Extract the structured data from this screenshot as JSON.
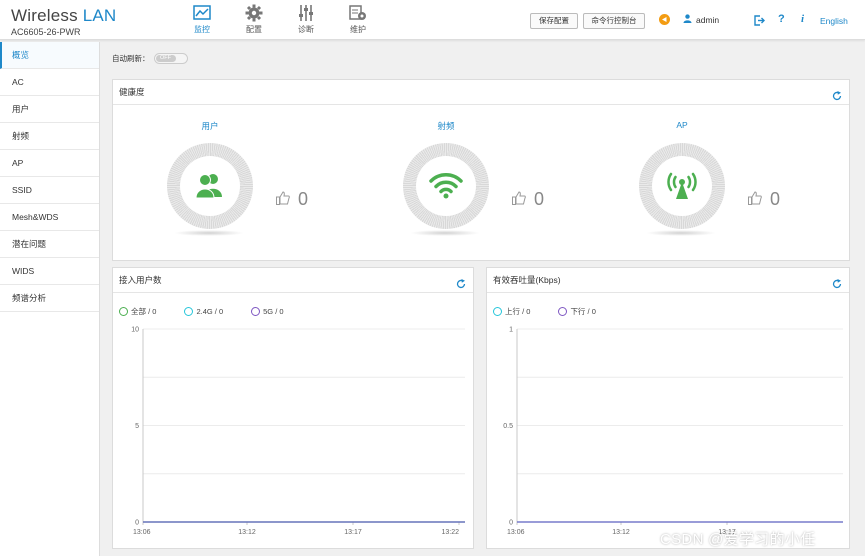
{
  "brand": {
    "title_main": "Wireless",
    "title_accent": "LAN",
    "model": "AC6605-26-PWR"
  },
  "nav": [
    {
      "label": "监控",
      "icon": "monitor-icon",
      "active": true
    },
    {
      "label": "配置",
      "icon": "gear-icon",
      "active": false
    },
    {
      "label": "诊断",
      "icon": "sliders-icon",
      "active": false
    },
    {
      "label": "维护",
      "icon": "maintenance-icon",
      "active": false
    }
  ],
  "header": {
    "save_label": "保存配置",
    "console_label": "命令行控制台",
    "user": "admin",
    "language": "English",
    "help_icon": "help-icon",
    "info_icon": "info-icon",
    "logout_icon": "logout-icon",
    "alarm_icon": "alarm-icon"
  },
  "sidebar": {
    "items": [
      {
        "label": "概览",
        "active": true
      },
      {
        "label": "AC",
        "active": false
      },
      {
        "label": "用户",
        "active": false
      },
      {
        "label": "射频",
        "active": false
      },
      {
        "label": "AP",
        "active": false
      },
      {
        "label": "SSID",
        "active": false
      },
      {
        "label": "Mesh&WDS",
        "active": false
      },
      {
        "label": "潜在问题",
        "active": false
      },
      {
        "label": "WIDS",
        "active": false
      },
      {
        "label": "频谱分析",
        "active": false
      }
    ]
  },
  "auto_refresh": {
    "label": "自动刷新：",
    "state": "OFF"
  },
  "health": {
    "title": "健康度",
    "items": [
      {
        "label": "用户",
        "icon": "users-icon",
        "score": "0"
      },
      {
        "label": "射频",
        "icon": "wifi-icon",
        "score": "0"
      },
      {
        "label": "AP",
        "icon": "access-point-icon",
        "score": "0"
      }
    ]
  },
  "users_panel": {
    "title": "接入用户数",
    "legend": [
      {
        "label": "全部 / 0",
        "color": "#4caf50"
      },
      {
        "label": "2.4G / 0",
        "color": "#26c6da"
      },
      {
        "label": "5G / 0",
        "color": "#7e57c2"
      }
    ]
  },
  "throughput_panel": {
    "title": "有效吞吐量(Kbps)",
    "legend": [
      {
        "label": "上行 / 0",
        "color": "#26c6da"
      },
      {
        "label": "下行 / 0",
        "color": "#7e57c2"
      }
    ]
  },
  "chart_data": [
    {
      "type": "line",
      "title": "接入用户数",
      "x": [
        "13:06",
        "13:12",
        "13:17",
        "13:22"
      ],
      "ylim": [
        0,
        10
      ],
      "yticks": [
        "10",
        "5",
        "0"
      ],
      "series": [
        {
          "name": "全部",
          "values": [
            0,
            0,
            0,
            0
          ]
        },
        {
          "name": "2.4G",
          "values": [
            0,
            0,
            0,
            0
          ]
        },
        {
          "name": "5G",
          "values": [
            0,
            0,
            0,
            0
          ]
        }
      ]
    },
    {
      "type": "line",
      "title": "有效吞吐量(Kbps)",
      "x": [
        "13:06",
        "13:12",
        "13:17"
      ],
      "ylim": [
        0,
        1
      ],
      "yticks": [
        "1",
        "0.5",
        "0"
      ],
      "series": [
        {
          "name": "上行",
          "values": [
            0,
            0,
            0
          ]
        },
        {
          "name": "下行",
          "values": [
            0,
            0,
            0
          ]
        }
      ]
    }
  ],
  "watermark": "CSDN @爱学习的小任"
}
